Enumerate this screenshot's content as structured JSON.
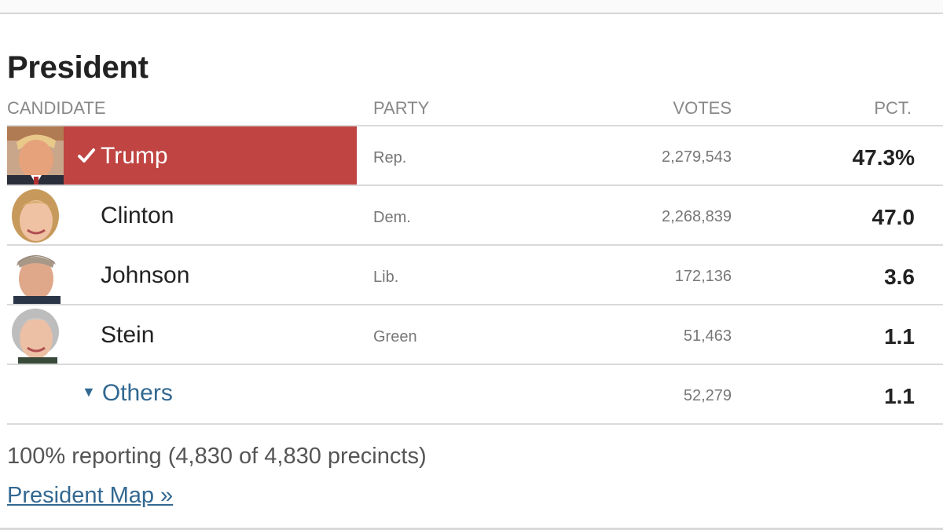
{
  "race": {
    "title": "President"
  },
  "columns": {
    "candidate": "CANDIDATE",
    "party": "PARTY",
    "votes": "VOTES",
    "pct": "PCT."
  },
  "candidates": [
    {
      "name": "Trump",
      "party": "Rep.",
      "votes": "2,279,543",
      "pct": "47.3%",
      "winner": true,
      "photo": "trump-photo"
    },
    {
      "name": "Clinton",
      "party": "Dem.",
      "votes": "2,268,839",
      "pct": "47.0",
      "winner": false,
      "photo": "clinton-photo"
    },
    {
      "name": "Johnson",
      "party": "Lib.",
      "votes": "172,136",
      "pct": "3.6",
      "winner": false,
      "photo": "johnson-photo"
    },
    {
      "name": "Stein",
      "party": "Green",
      "votes": "51,463",
      "pct": "1.1",
      "winner": false,
      "photo": "stein-photo"
    }
  ],
  "others": {
    "label": "Others",
    "icon": "triangle-down-icon",
    "votes": "52,279",
    "pct": "1.1"
  },
  "reporting": "100% reporting (4,830 of 4,830 precincts)",
  "map_link": "President Map »",
  "colors": {
    "winner_bg": "#bf4442",
    "link": "#326891"
  }
}
